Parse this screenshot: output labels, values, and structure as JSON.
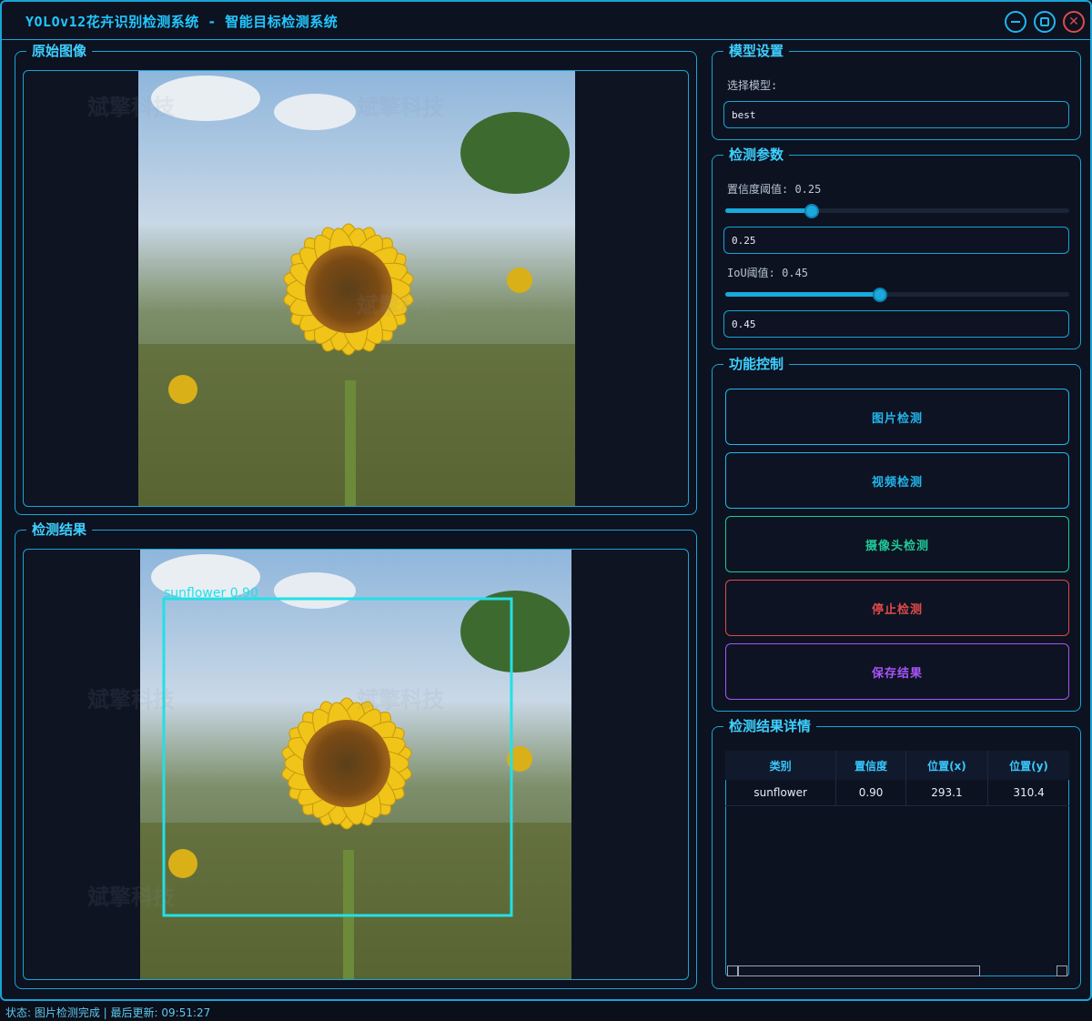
{
  "window": {
    "title": "YOLOv12花卉识别检测系统 - 智能目标检测系统",
    "controls": [
      "minimize-icon",
      "maximize-icon",
      "close-icon"
    ]
  },
  "watermark": "斌擎科技",
  "original_panel": {
    "title": "原始图像"
  },
  "result_panel": {
    "title": "检测结果",
    "detection_label": "sunflower 0.90",
    "box_color": "#22e0e6"
  },
  "model_settings": {
    "title": "模型设置",
    "select_label": "选择模型:",
    "model_value": "best"
  },
  "detect_params": {
    "title": "检测参数",
    "conf_label": "置信度阈值: 0.25",
    "conf_value": "0.25",
    "conf_level": 0.25,
    "iou_label": "IoU阈值: 0.45",
    "iou_value": "0.45",
    "iou_level": 0.45
  },
  "controls": {
    "title": "功能控制",
    "buttons": [
      {
        "label": "图片检测",
        "color": "#22b6ee"
      },
      {
        "label": "视频检测",
        "color": "#22b6ee"
      },
      {
        "label": "摄像头检测",
        "color": "#20c997"
      },
      {
        "label": "停止检测",
        "color": "#e04a4a"
      },
      {
        "label": "保存结果",
        "color": "#a855f7"
      }
    ]
  },
  "results": {
    "title": "检测结果详情",
    "columns": [
      "类别",
      "置信度",
      "位置(x)",
      "位置(y)"
    ],
    "rows": [
      [
        "sunflower",
        "0.90",
        "293.1",
        "310.4"
      ]
    ]
  },
  "status": {
    "text": "状态: 图片检测完成 | 最后更新: 09:51:27"
  }
}
